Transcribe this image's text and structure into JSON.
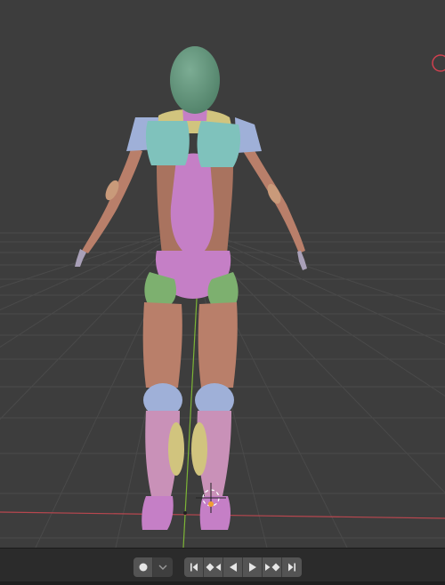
{
  "viewport": {
    "background": "#3d3d3d",
    "grid_color": "#4a4a4a",
    "x_axis_color": "#b8474f",
    "y_axis_color": "#7db536",
    "content": "3d-character-mannequin-back-view"
  },
  "timeline": {
    "keying_icon": "record-dot-icon",
    "keying_dropdown_icon": "chevron-down-icon",
    "playback_icons": [
      "jump-to-start-icon",
      "previous-keyframe-icon",
      "play-reverse-icon",
      "play-icon",
      "next-keyframe-icon",
      "jump-to-end-icon"
    ]
  }
}
